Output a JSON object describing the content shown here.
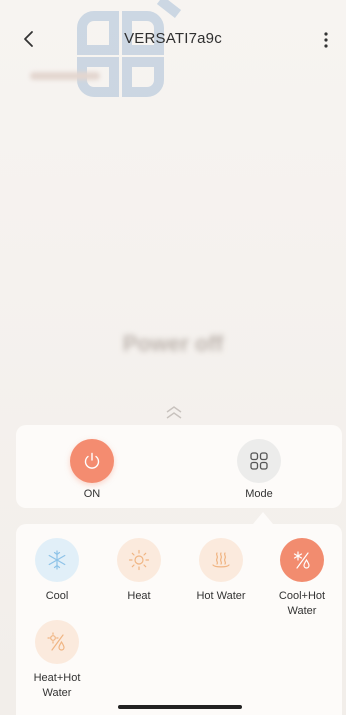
{
  "header": {
    "title": "VERSATI7a9c",
    "back_icon": "chevron-left-icon",
    "more_icon": "more-vertical-icon"
  },
  "main": {
    "status_text": "Power off"
  },
  "controls": {
    "power": {
      "label": "ON",
      "icon": "power-icon",
      "color": "#f48c70"
    },
    "mode": {
      "label": "Mode",
      "icon": "grid-icon"
    }
  },
  "modes": [
    {
      "label": "Cool",
      "icon": "snowflake-icon",
      "color": "#8ec3e8"
    },
    {
      "label": "Heat",
      "icon": "sun-icon",
      "color": "#f0b583"
    },
    {
      "label": "Hot Water",
      "icon": "hot-water-icon",
      "color": "#f0b583"
    },
    {
      "label": "Cool+Hot Water",
      "icon": "cool-hot-water-icon",
      "color": "#f28c6f",
      "selected": true
    },
    {
      "label": "Heat+Hot Water",
      "icon": "heat-hot-water-icon",
      "color": "#f0b583"
    }
  ]
}
